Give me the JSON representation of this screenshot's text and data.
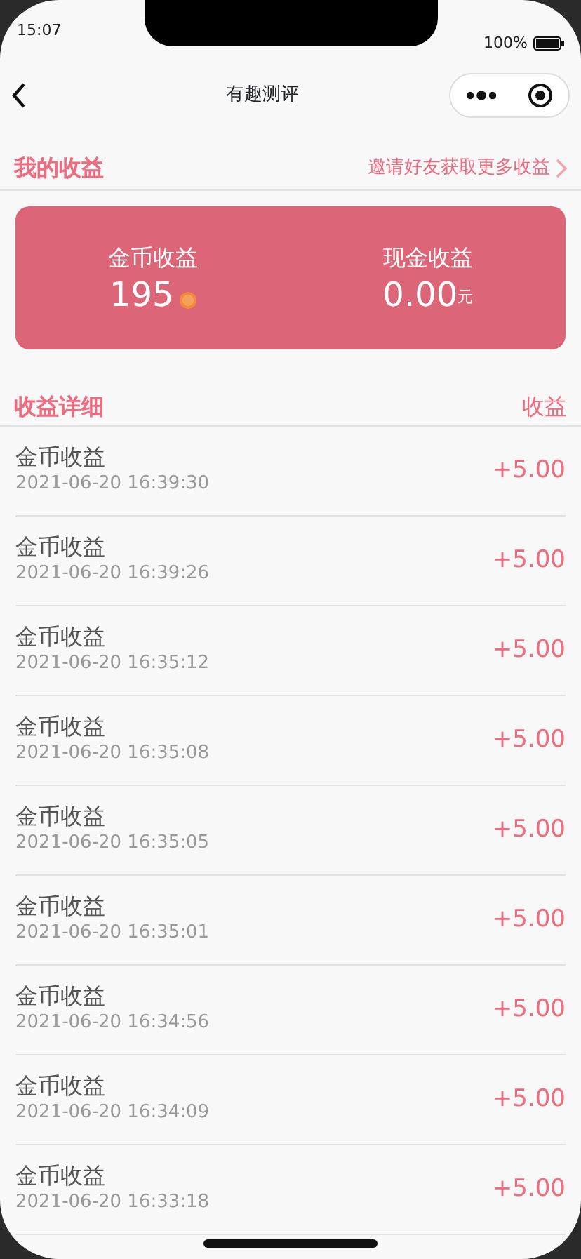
{
  "status_bar": {
    "time": "15:07",
    "battery": "100%"
  },
  "nav": {
    "title": "有趣测评"
  },
  "earnings": {
    "title": "我的收益",
    "invite_link": "邀请好友获取更多收益",
    "items": [
      {
        "kind": "coin",
        "label": "金币收益",
        "value": "195"
      },
      {
        "kind": "cash",
        "label": "现金收益",
        "value": "0.00",
        "unit": "元"
      }
    ]
  },
  "details": {
    "title": "收益详细",
    "column": "收益",
    "rows": [
      {
        "name": "金币收益",
        "time": "2021-06-20 16:39:30",
        "amount": "+5.00"
      },
      {
        "name": "金币收益",
        "time": "2021-06-20 16:39:26",
        "amount": "+5.00"
      },
      {
        "name": "金币收益",
        "time": "2021-06-20 16:35:12",
        "amount": "+5.00"
      },
      {
        "name": "金币收益",
        "time": "2021-06-20 16:35:08",
        "amount": "+5.00"
      },
      {
        "name": "金币收益",
        "time": "2021-06-20 16:35:05",
        "amount": "+5.00"
      },
      {
        "name": "金币收益",
        "time": "2021-06-20 16:35:01",
        "amount": "+5.00"
      },
      {
        "name": "金币收益",
        "time": "2021-06-20 16:34:56",
        "amount": "+5.00"
      },
      {
        "name": "金币收益",
        "time": "2021-06-20 16:34:09",
        "amount": "+5.00"
      },
      {
        "name": "金币收益",
        "time": "2021-06-20 16:33:18",
        "amount": "+5.00"
      }
    ]
  }
}
